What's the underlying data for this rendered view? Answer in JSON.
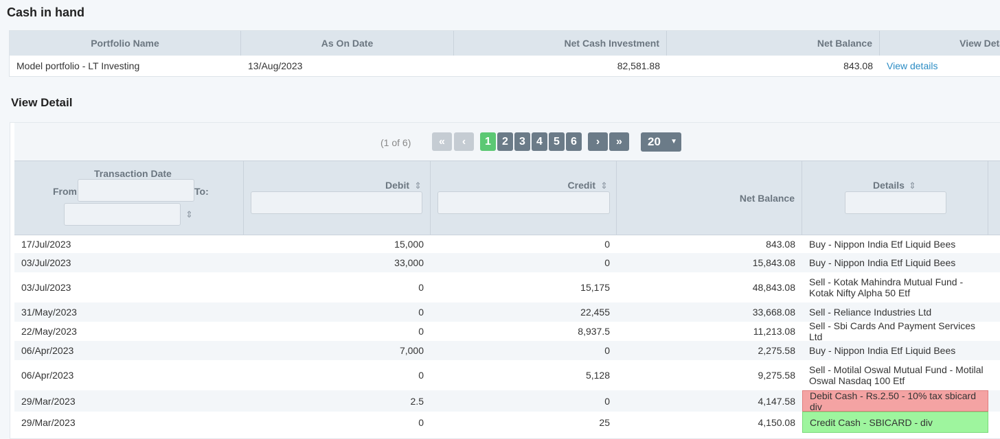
{
  "page": {
    "title": "Cash in hand"
  },
  "summary": {
    "headers": [
      "Portfolio Name",
      "As On Date",
      "Net Cash Investment",
      "Net Balance",
      "View Deta"
    ],
    "row": {
      "portfolio": "Model portfolio - LT Investing",
      "date": "13/Aug/2023",
      "net_cash_investment": "82,581.88",
      "net_balance": "843.08",
      "view_link": "View details"
    }
  },
  "detail": {
    "title": "View Detail",
    "pager": {
      "info": "(1 of 6)",
      "first": "«",
      "prev": "‹",
      "pages": [
        "1",
        "2",
        "3",
        "4",
        "5",
        "6"
      ],
      "next": "›",
      "last": "»",
      "page_size": "20",
      "active_page": "1"
    },
    "columns": {
      "date": "Transaction Date",
      "from": "From:",
      "to": "To:",
      "debit": "Debit",
      "credit": "Credit",
      "net_balance": "Net Balance",
      "details": "Details",
      "sort_icon": "⇕"
    },
    "rows": [
      {
        "date": "17/Jul/2023",
        "debit": "15,000",
        "credit": "0",
        "balance": "843.08",
        "details": "Buy - Nippon India Etf Liquid Bees"
      },
      {
        "date": "03/Jul/2023",
        "debit": "33,000",
        "credit": "0",
        "balance": "15,843.08",
        "details": "Buy - Nippon India Etf Liquid Bees"
      },
      {
        "date": "03/Jul/2023",
        "debit": "0",
        "credit": "15,175",
        "balance": "48,843.08",
        "details": "Sell - Kotak Mahindra Mutual Fund - Kotak Nifty Alpha 50 Etf"
      },
      {
        "date": "31/May/2023",
        "debit": "0",
        "credit": "22,455",
        "balance": "33,668.08",
        "details": "Sell - Reliance Industries Ltd"
      },
      {
        "date": "22/May/2023",
        "debit": "0",
        "credit": "8,937.5",
        "balance": "11,213.08",
        "details": "Sell - Sbi Cards And Payment Services Ltd"
      },
      {
        "date": "06/Apr/2023",
        "debit": "7,000",
        "credit": "0",
        "balance": "2,275.58",
        "details": "Buy - Nippon India Etf Liquid Bees"
      },
      {
        "date": "06/Apr/2023",
        "debit": "0",
        "credit": "5,128",
        "balance": "9,275.58",
        "details": "Sell - Motilal Oswal Mutual Fund - Motilal Oswal Nasdaq 100 Etf"
      },
      {
        "date": "29/Mar/2023",
        "debit": "2.5",
        "credit": "0",
        "balance": "4,147.58",
        "details": "Debit Cash - Rs.2.50 - 10% tax sbicard div"
      },
      {
        "date": "29/Mar/2023",
        "debit": "0",
        "credit": "25",
        "balance": "4,150.08",
        "details": "Credit Cash - SBICARD - div"
      }
    ],
    "colors": {
      "debit_highlight": "#f4a3a3",
      "credit_highlight": "#9ef59e",
      "active_page": "#5cc874"
    }
  }
}
